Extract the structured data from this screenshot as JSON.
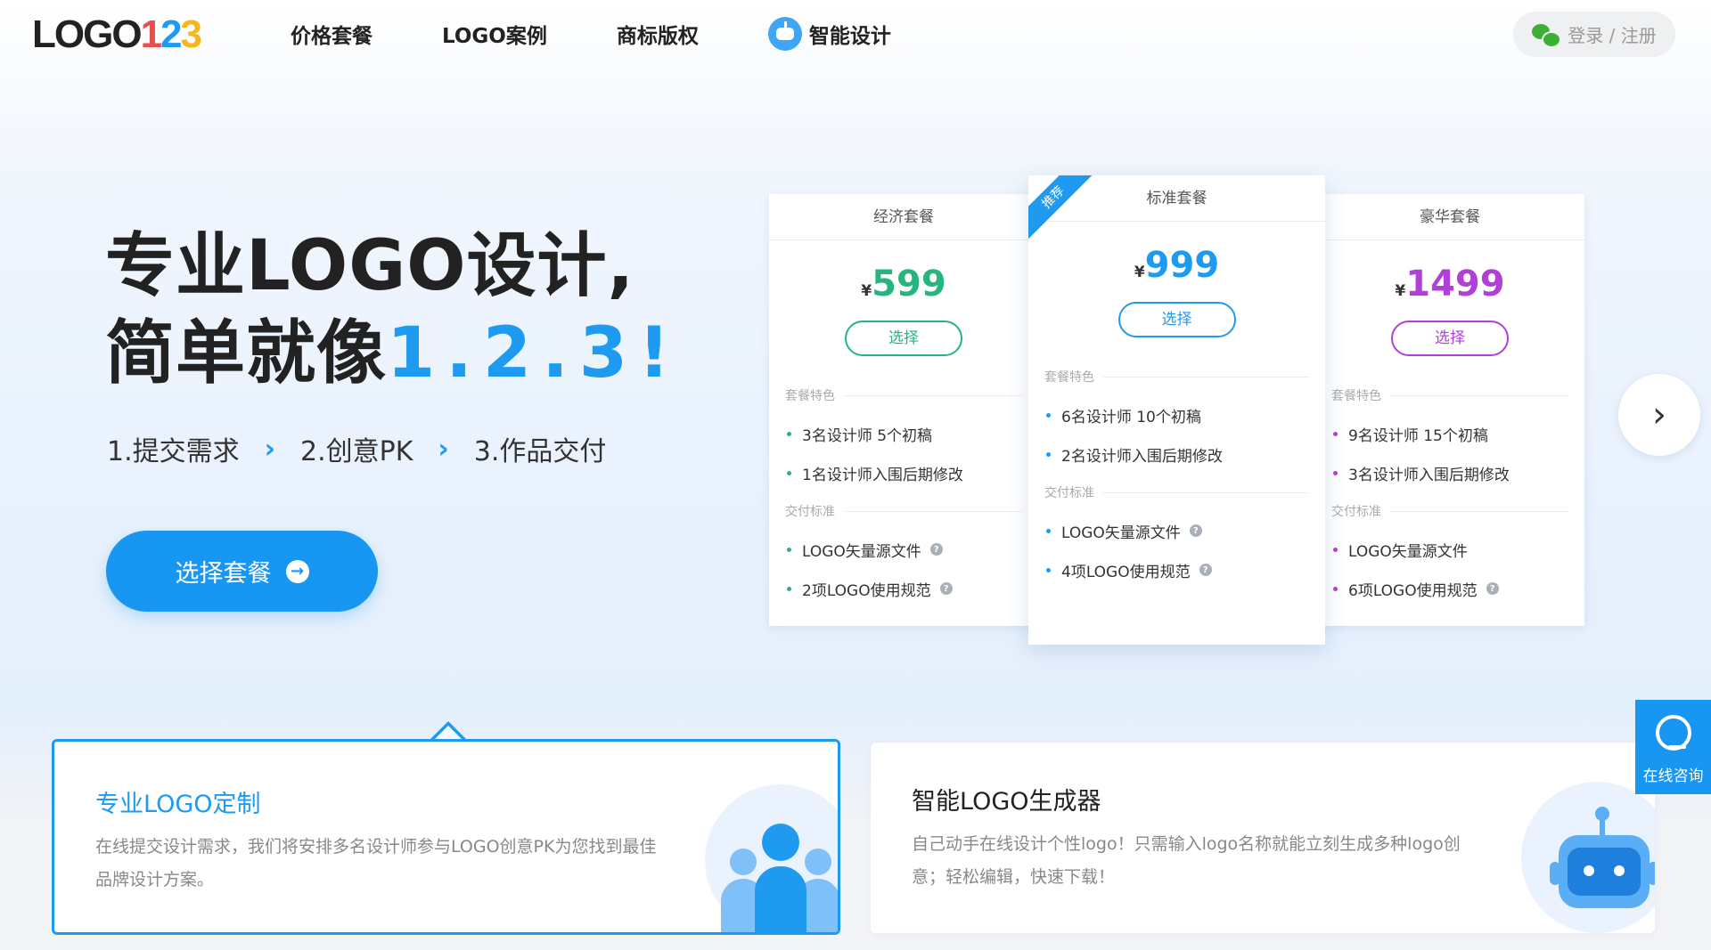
{
  "header": {
    "logo": {
      "word": "LOGO",
      "d1": "1",
      "d2": "2",
      "d3": "3"
    },
    "nav": [
      {
        "label": "价格套餐"
      },
      {
        "label": "LOGO案例"
      },
      {
        "label": "商标版权"
      },
      {
        "label": "智能设计",
        "icon": "robot-icon"
      }
    ],
    "login": {
      "label": "登录 / 注册",
      "icon": "wechat-icon"
    }
  },
  "hero": {
    "line1": "专业LOGO设计,",
    "line2_prefix": "简单就像",
    "line2_accent": "1.2.3!",
    "steps": [
      "1.提交需求",
      "2.创意PK",
      "3.作品交付"
    ],
    "cta_label": "选择套餐"
  },
  "plans": [
    {
      "name": "经济套餐",
      "currency": "¥",
      "price": "599",
      "select_label": "选择",
      "features_title": "套餐特色",
      "features": [
        "3名设计师 5个初稿",
        "1名设计师入围后期修改"
      ],
      "delivery_title": "交付标准",
      "delivery": [
        "LOGO矢量源文件",
        "2项LOGO使用规范"
      ]
    },
    {
      "name": "标准套餐",
      "badge": "推荐",
      "currency": "¥",
      "price": "999",
      "select_label": "选择",
      "features_title": "套餐特色",
      "features": [
        "6名设计师 10个初稿",
        "2名设计师入围后期修改"
      ],
      "delivery_title": "交付标准",
      "delivery": [
        "LOGO矢量源文件",
        "4项LOGO使用规范"
      ]
    },
    {
      "name": "豪华套餐",
      "currency": "¥",
      "price": "1499",
      "select_label": "选择",
      "features_title": "套餐特色",
      "features": [
        "9名设计师 15个初稿",
        "3名设计师入围后期修改"
      ],
      "delivery_title": "交付标准",
      "delivery": [
        "LOGO矢量源文件",
        "6项LOGO使用规范"
      ]
    }
  ],
  "services": [
    {
      "title": "专业LOGO定制",
      "desc": "在线提交设计需求，我们将安排多名设计师参与LOGO创意PK为您找到最佳品牌设计方案。",
      "icon": "designers-icon"
    },
    {
      "title": "智能LOGO生成器",
      "desc": "自己动手在线设计个性logo！只需输入logo名称就能立刻生成多种logo创意；轻松编辑，快速下载！",
      "icon": "robot-icon"
    }
  ],
  "float": {
    "consult_label": "在线咨询"
  },
  "colors": {
    "primary": "#1e9bf0",
    "eco": "#26b47f",
    "lux": "#b13fd8"
  }
}
